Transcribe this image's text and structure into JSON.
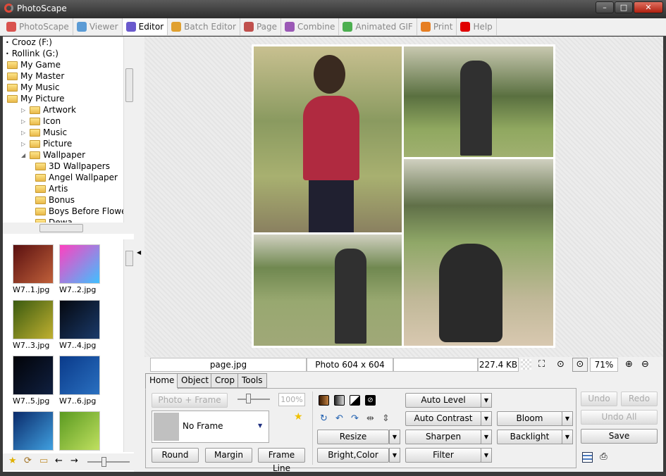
{
  "window": {
    "title": "PhotoScape",
    "minimize": "–",
    "maximize": "□",
    "close": "✕"
  },
  "tabs": [
    {
      "label": "PhotoScape",
      "color": "#d9534f"
    },
    {
      "label": "Viewer",
      "color": "#5b9bd5"
    },
    {
      "label": "Editor",
      "color": "#6a5acd",
      "active": true
    },
    {
      "label": "Batch Editor",
      "color": "#e0a030"
    },
    {
      "label": "Page",
      "color": "#c0504d"
    },
    {
      "label": "Combine",
      "color": "#9b59b6"
    },
    {
      "label": "Animated GIF",
      "color": "#4caf50"
    },
    {
      "label": "Print",
      "color": "#e67e22"
    },
    {
      "label": "Help",
      "color": "#e00000"
    }
  ],
  "tree": [
    {
      "label": "Crooz (F:)",
      "level": 0,
      "type": "drive"
    },
    {
      "label": "Rollink (G:)",
      "level": 0,
      "type": "drive"
    },
    {
      "label": "My Game",
      "level": 0
    },
    {
      "label": "My Master",
      "level": 0
    },
    {
      "label": "My Music",
      "level": 0
    },
    {
      "label": "My Picture",
      "level": 0
    },
    {
      "label": "Artwork",
      "level": 1,
      "expander": "▷"
    },
    {
      "label": "Icon",
      "level": 1,
      "expander": "▷"
    },
    {
      "label": "Music",
      "level": 1,
      "expander": "▷"
    },
    {
      "label": "Picture",
      "level": 1,
      "expander": "▷"
    },
    {
      "label": "Wallpaper",
      "level": 1,
      "expander": "◢"
    },
    {
      "label": "3D Wallpapers",
      "level": 2
    },
    {
      "label": "Angel Wallpaper",
      "level": 2
    },
    {
      "label": "Artis",
      "level": 2
    },
    {
      "label": "Bonus",
      "level": 2
    },
    {
      "label": "Boys Before Flowe",
      "level": 2
    },
    {
      "label": "Dewa",
      "level": 2
    }
  ],
  "thumbnails": [
    {
      "label": "W7..1.jpg",
      "colors": [
        "#5a1010",
        "#c0603a"
      ]
    },
    {
      "label": "W7..2.jpg",
      "colors": [
        "#ff40c0",
        "#40c0ff"
      ]
    },
    {
      "label": "W7..3.jpg",
      "colors": [
        "#3a5a10",
        "#c0b030"
      ]
    },
    {
      "label": "W7..4.jpg",
      "colors": [
        "#05080f",
        "#1a3a6a"
      ]
    },
    {
      "label": "W7..5.jpg",
      "colors": [
        "#020308",
        "#102040"
      ]
    },
    {
      "label": "W7..6.jpg",
      "colors": [
        "#0a3a8a",
        "#2a70c0"
      ]
    },
    {
      "label": "",
      "colors": [
        "#0a2a6a",
        "#40a0e0"
      ]
    },
    {
      "label": "",
      "colors": [
        "#5a9a20",
        "#c0e060"
      ]
    }
  ],
  "status": {
    "filename": "page.jpg",
    "dimensions": "Photo 604 x 604",
    "empty": "",
    "filesize": "227.4 KB",
    "zoom": "71%"
  },
  "panel_tabs": [
    "Home",
    "Object",
    "Crop",
    "Tools"
  ],
  "home": {
    "photo_frame": "Photo + Frame",
    "frame_percent": "100%",
    "frame_name": "No Frame",
    "round": "Round",
    "margin": "Margin",
    "frame_line": "Frame Line",
    "resize": "Resize",
    "bright_color": "Bright,Color",
    "auto_level": "Auto Level",
    "auto_contrast": "Auto Contrast",
    "sharpen": "Sharpen",
    "filter": "Filter",
    "bloom": "Bloom",
    "backlight": "Backlight"
  },
  "actions": {
    "undo": "Undo",
    "redo": "Redo",
    "undo_all": "Undo All",
    "save": "Save"
  }
}
